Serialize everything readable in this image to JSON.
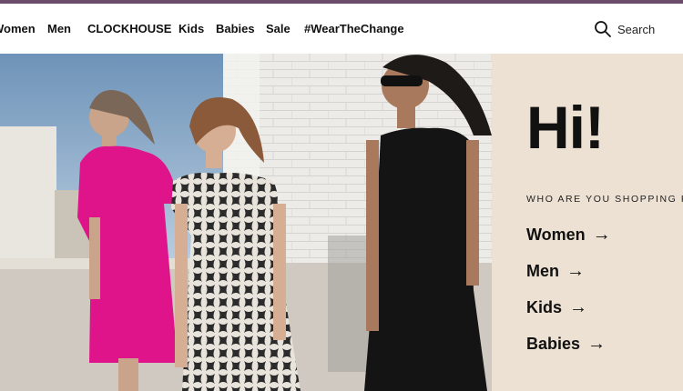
{
  "nav": {
    "items": [
      {
        "label": "Women"
      },
      {
        "label": "Men"
      },
      {
        "label": "CLOCKHOUSE"
      },
      {
        "label": "Kids"
      },
      {
        "label": "Babies"
      },
      {
        "label": "Sale"
      },
      {
        "label": "#WearTheChange"
      }
    ],
    "search_label": "Search"
  },
  "hero": {
    "image": "three-women-in-summer-dresses"
  },
  "panel": {
    "greeting": "Hi!",
    "prompt": "WHO ARE YOU SHOPPING FOR?",
    "links": [
      {
        "label": "Women",
        "arrow": "→"
      },
      {
        "label": "Men",
        "arrow": "→"
      },
      {
        "label": "Kids",
        "arrow": "→"
      },
      {
        "label": "Babies",
        "arrow": "→"
      }
    ]
  },
  "colors": {
    "accent_strip": "#6b4a6a",
    "panel_bg": "#ede1d3",
    "text": "#111111"
  }
}
